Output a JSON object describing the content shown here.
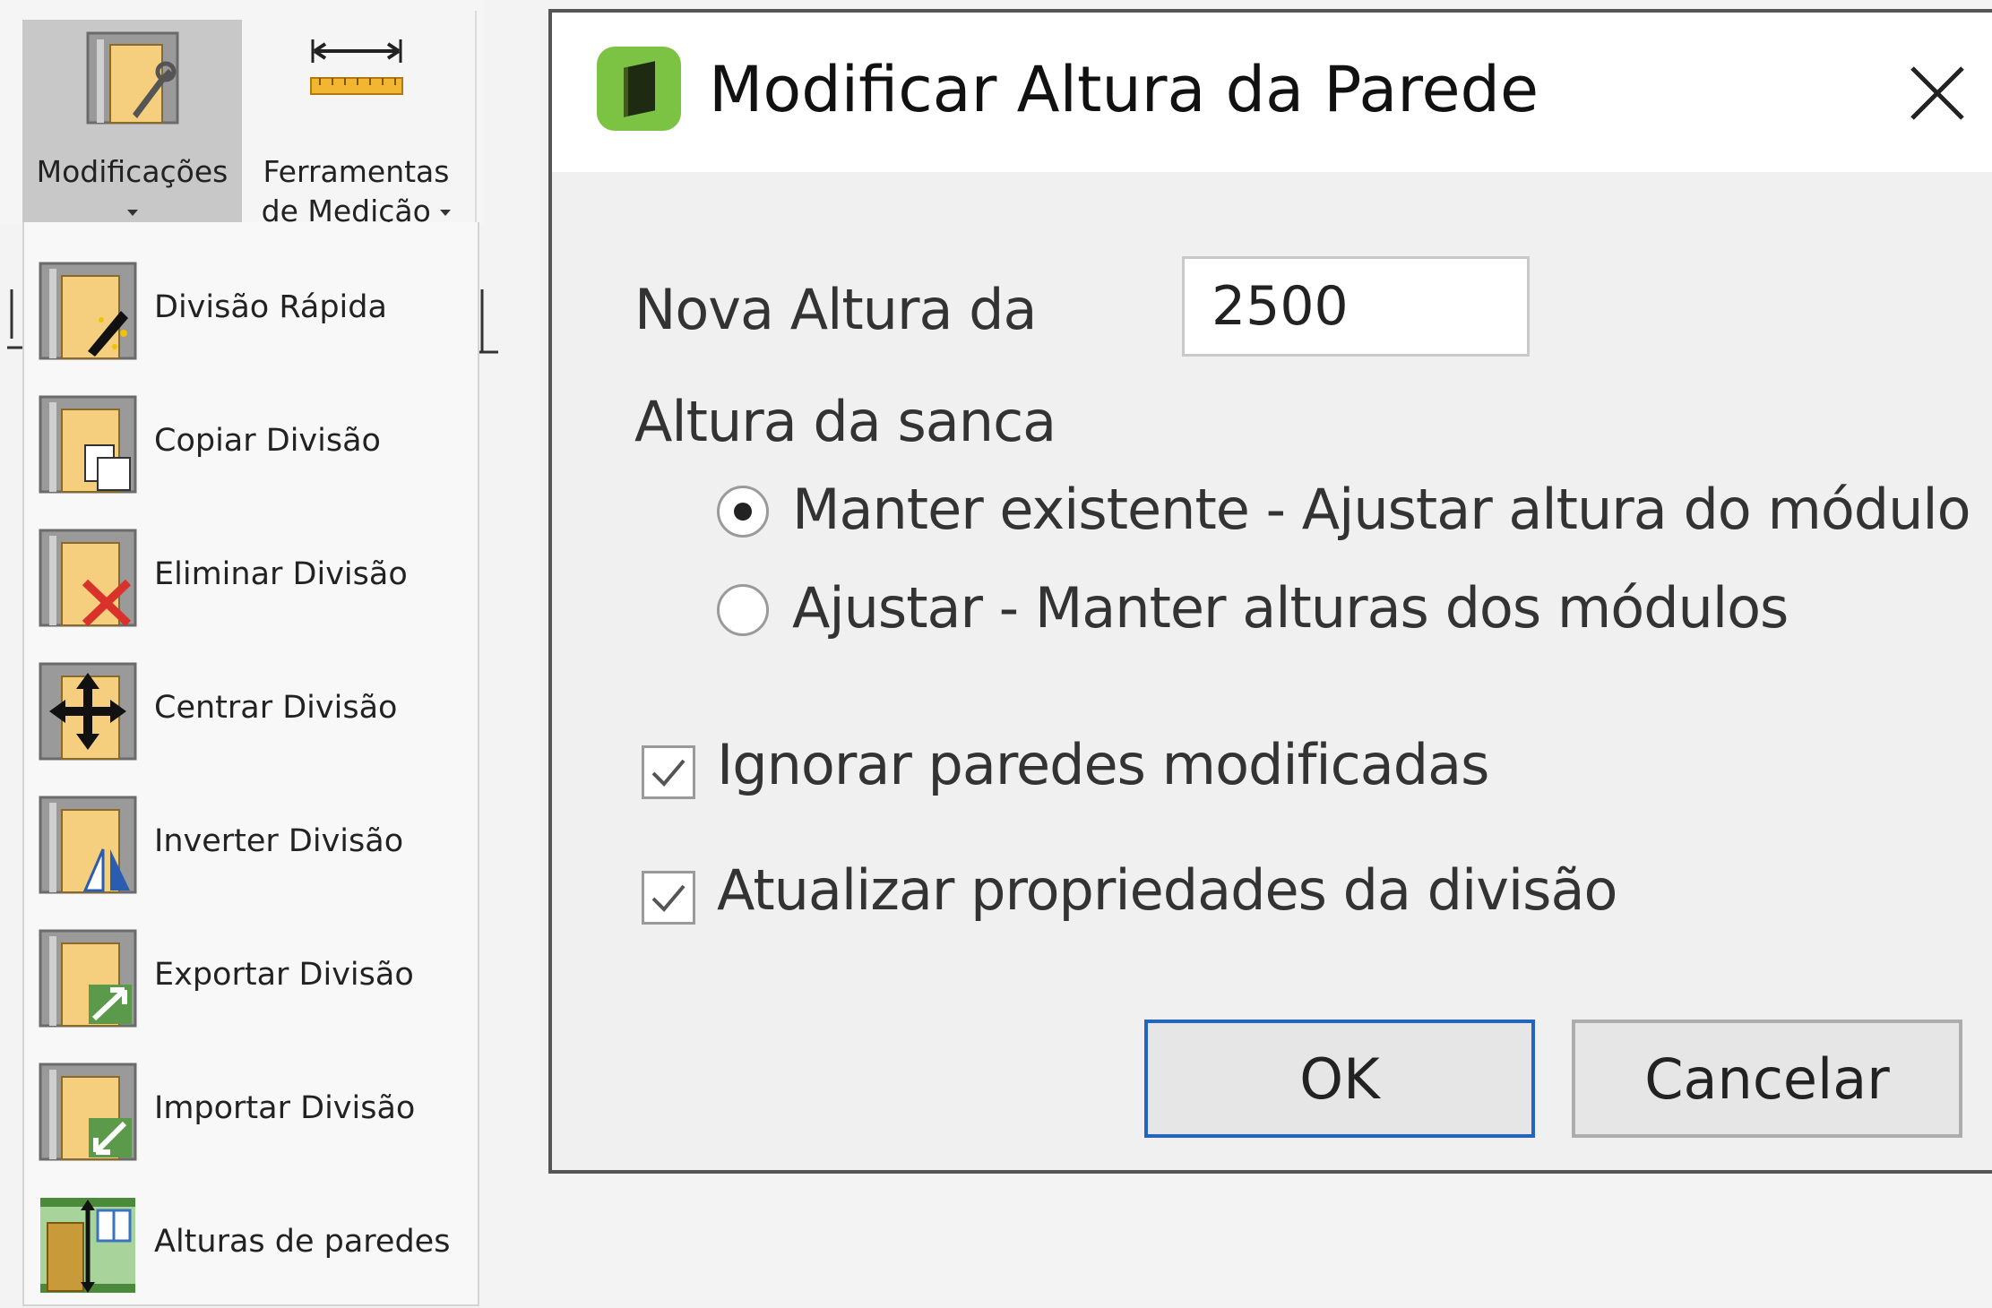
{
  "ribbon": {
    "modificacoes": {
      "label": "Modificações",
      "icon": "wall-wrench-icon",
      "active": true
    },
    "ferramentas": {
      "label_line1": "Ferramentas",
      "label_line2": "de Medição",
      "icon": "measuring-tape-icon"
    }
  },
  "menu": {
    "items": [
      {
        "label": "Divisão Rápida",
        "icon": "quick-division-icon"
      },
      {
        "label": "Copiar Divisão",
        "icon": "copy-division-icon"
      },
      {
        "label": "Eliminar Divisão",
        "icon": "delete-division-icon"
      },
      {
        "label": "Centrar Divisão",
        "icon": "center-division-icon"
      },
      {
        "label": "Inverter Divisão",
        "icon": "mirror-division-icon"
      },
      {
        "label": "Exportar Divisão",
        "icon": "export-division-icon"
      },
      {
        "label": "Importar Divisão",
        "icon": "import-division-icon"
      },
      {
        "label": "Alturas de paredes",
        "icon": "wall-heights-icon"
      }
    ]
  },
  "dialog": {
    "title": "Modificar Altura da Parede",
    "icon": "app-icon",
    "height_label": "Nova Altura da",
    "height_value": "2500",
    "sanca_label": "Altura da sanca",
    "radio_options": [
      {
        "label": "Manter existente - Ajustar altura do módulo",
        "selected": true
      },
      {
        "label": "Ajustar - Manter alturas dos módulos",
        "selected": false
      }
    ],
    "checkboxes": [
      {
        "label": "Ignorar paredes modificadas",
        "checked": true
      },
      {
        "label": "Atualizar propriedades da divisão",
        "checked": true
      }
    ],
    "ok_label": "OK",
    "cancel_label": "Cancelar"
  },
  "colors": {
    "accent": "#2563c0",
    "app_icon": "#7dc343",
    "door_fill": "#f5cf7e",
    "menu_bg": "#f8f8f8",
    "dialog_bg": "#f0f0f0"
  }
}
